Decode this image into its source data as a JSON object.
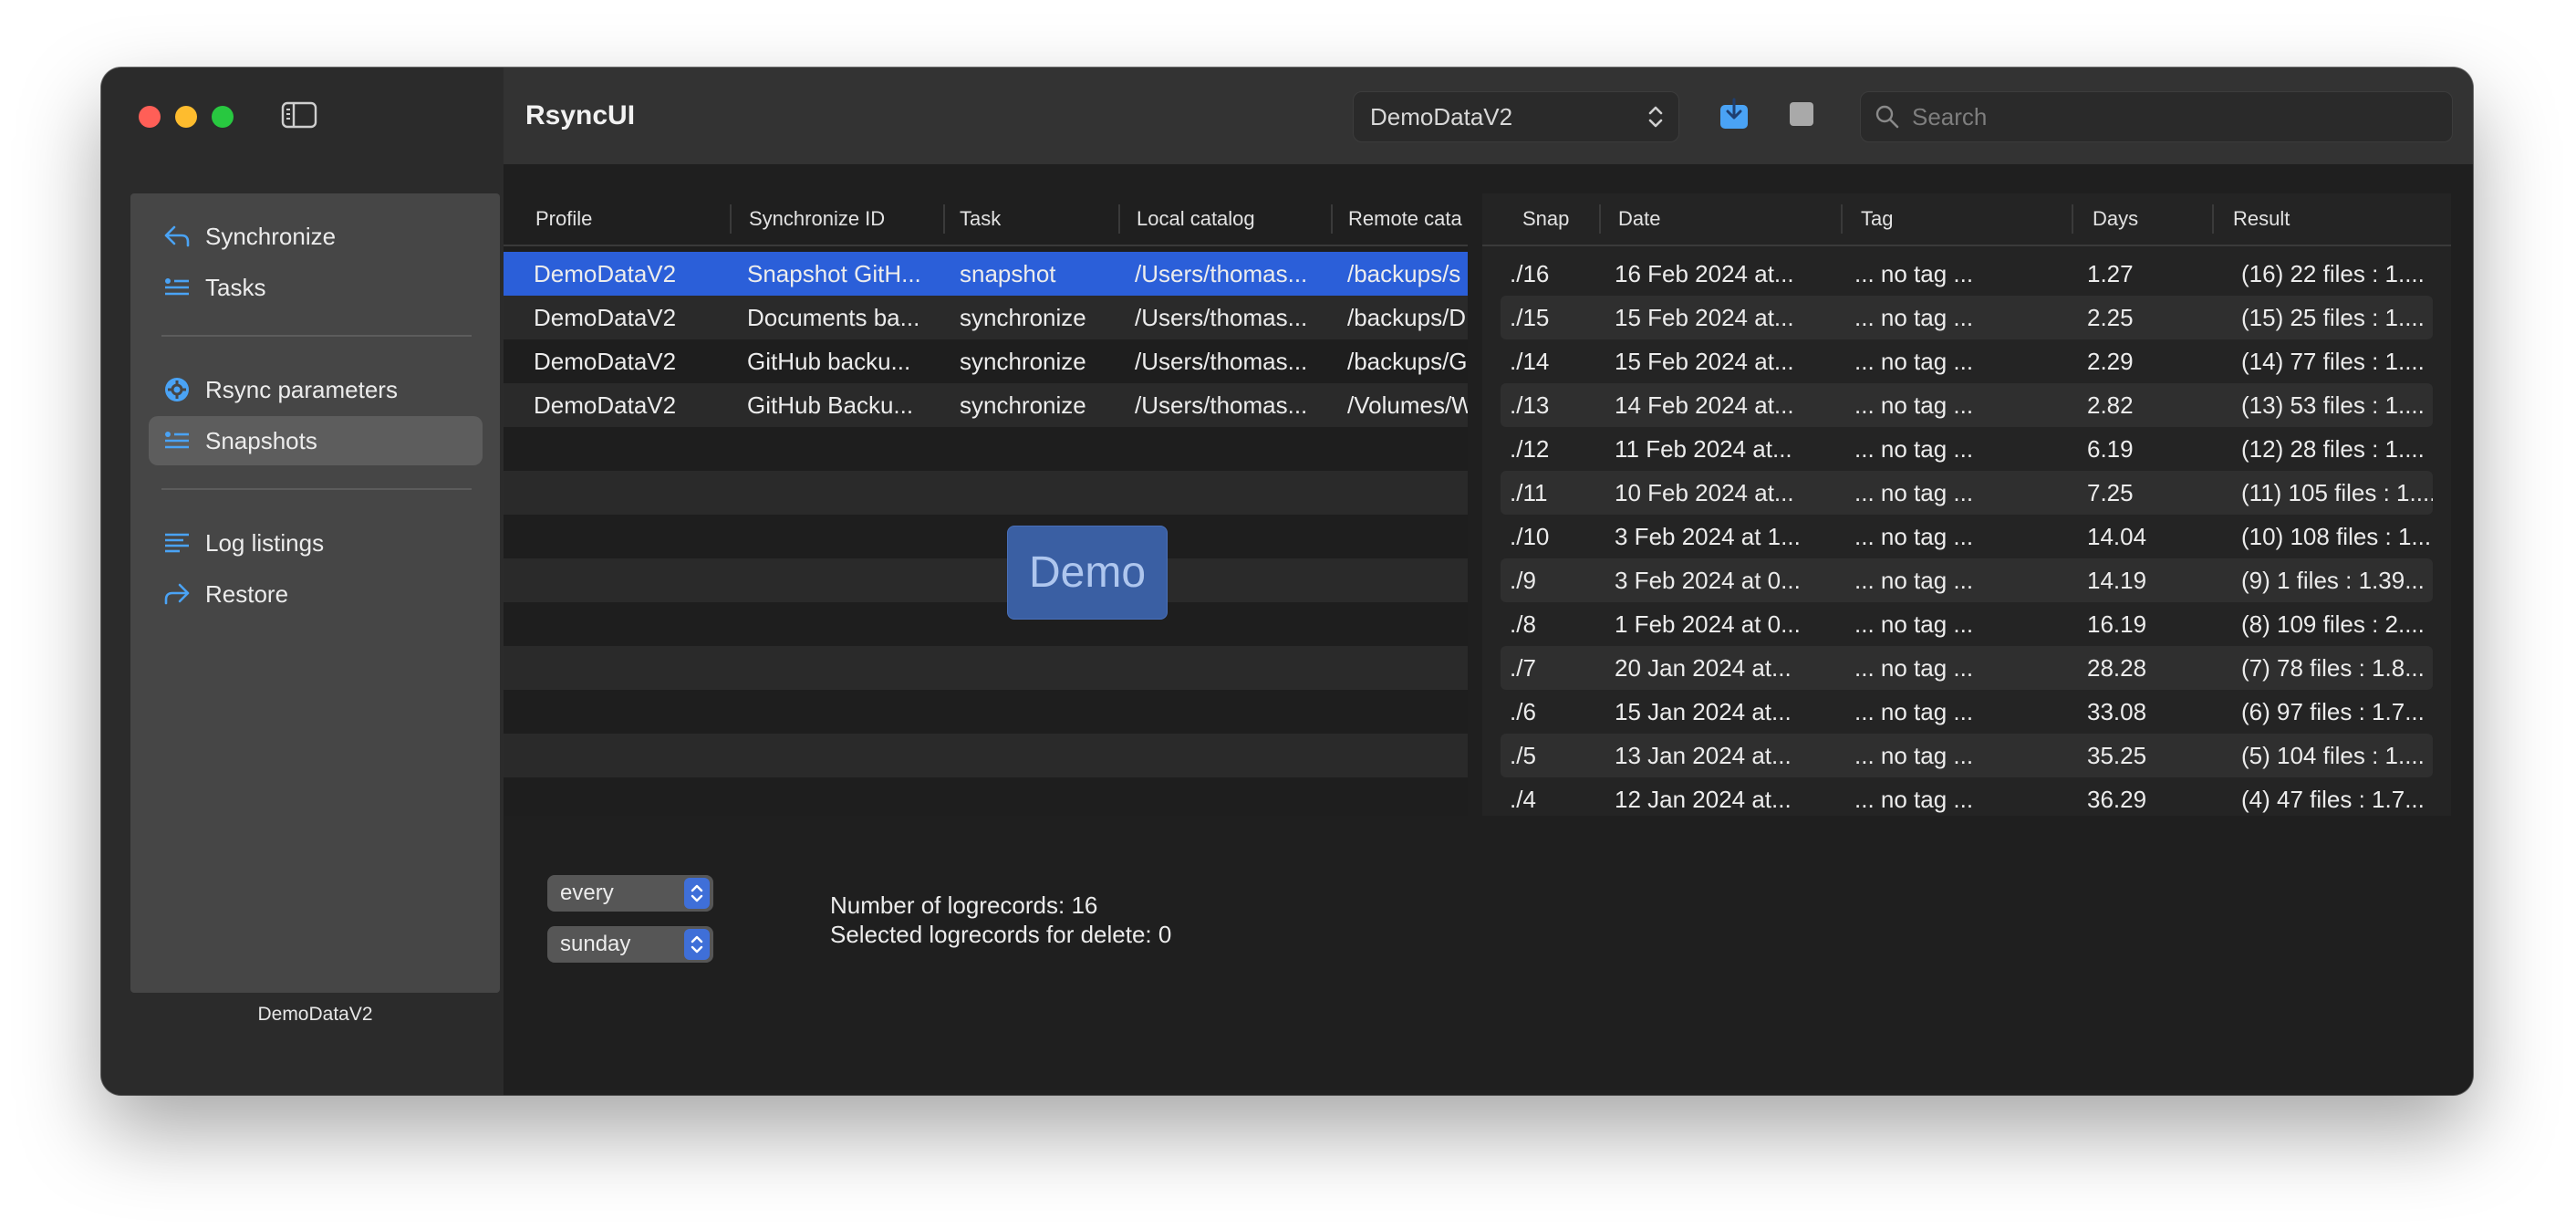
{
  "app": {
    "title": "RsyncUI"
  },
  "sidebar": {
    "group1": [
      {
        "label": "Synchronize",
        "icon": "sync-arrow-icon"
      },
      {
        "label": "Tasks",
        "icon": "task-list-icon"
      }
    ],
    "group2": [
      {
        "label": "Rsync parameters",
        "icon": "gear-badge-icon"
      },
      {
        "label": "Snapshots",
        "icon": "snapshot-list-icon",
        "selected": true
      }
    ],
    "group3": [
      {
        "label": "Log listings",
        "icon": "log-lines-icon"
      },
      {
        "label": "Restore",
        "icon": "restore-arrow-icon"
      }
    ],
    "profile": "DemoDataV2"
  },
  "toolbar": {
    "profile_select": "DemoDataV2",
    "search_placeholder": "Search"
  },
  "tasks_table": {
    "columns": [
      "Profile",
      "Synchronize ID",
      "Task",
      "Local catalog",
      "Remote cata"
    ],
    "rows": [
      [
        "DemoDataV2",
        "Snapshot GitH...",
        "snapshot",
        "/Users/thomas...",
        "/backups/s"
      ],
      [
        "DemoDataV2",
        "Documents ba...",
        "synchronize",
        "/Users/thomas...",
        "/backups/D"
      ],
      [
        "DemoDataV2",
        "GitHub backu...",
        "synchronize",
        "/Users/thomas...",
        "/backups/G"
      ],
      [
        "DemoDataV2",
        "GitHub Backu...",
        "synchronize",
        "/Users/thomas...",
        "/Volumes/W"
      ]
    ],
    "selected_row": 0
  },
  "demo_badge": "Demo",
  "snapshots_table": {
    "columns": [
      "Snap",
      "Date",
      "Tag",
      "Days",
      "Result"
    ],
    "rows": [
      [
        "./16",
        "16 Feb 2024 at...",
        "... no tag ...",
        "1.27",
        "(16) 22 files : 1...."
      ],
      [
        "./15",
        "15 Feb 2024 at...",
        "... no tag ...",
        "2.25",
        "(15) 25 files : 1...."
      ],
      [
        "./14",
        "15 Feb 2024 at...",
        "... no tag ...",
        "2.29",
        "(14) 77 files : 1...."
      ],
      [
        "./13",
        "14 Feb 2024 at...",
        "... no tag ...",
        "2.82",
        "(13) 53 files : 1...."
      ],
      [
        "./12",
        "11 Feb 2024 at...",
        "... no tag ...",
        "6.19",
        "(12) 28 files : 1...."
      ],
      [
        "./11",
        "10 Feb 2024 at...",
        "... no tag ...",
        "7.25",
        "(11) 105 files : 1...."
      ],
      [
        "./10",
        "3 Feb 2024 at 1...",
        "... no tag ...",
        "14.04",
        "(10) 108 files : 1...."
      ],
      [
        "./9",
        "3 Feb 2024 at 0...",
        "... no tag ...",
        "14.19",
        "(9) 1 files : 1.39..."
      ],
      [
        "./8",
        "1 Feb 2024 at 0...",
        "... no tag ...",
        "16.19",
        "(8) 109 files : 2...."
      ],
      [
        "./7",
        "20 Jan 2024 at...",
        "... no tag ...",
        "28.28",
        "(7) 78 files : 1.8..."
      ],
      [
        "./6",
        "15 Jan 2024 at...",
        "... no tag ...",
        "33.08",
        "(6) 97 files : 1.7..."
      ],
      [
        "./5",
        "13 Jan 2024 at...",
        "... no tag ...",
        "35.25",
        "(5) 104 files : 1...."
      ],
      [
        "./4",
        "12 Jan 2024 at...",
        "... no tag ...",
        "36.29",
        "(4) 47 files : 1.7..."
      ]
    ]
  },
  "bottom": {
    "plan_select": "every",
    "day_select": "sunday",
    "num_logrecords": "Number of logrecords: 16",
    "selected_for_delete": "Selected logrecords for delete: 0"
  },
  "colors": {
    "accent": "#2b5fd9",
    "accent_icon": "#4aa3f5",
    "window_bg": "#262626",
    "sidebar_panel": "#464646"
  }
}
